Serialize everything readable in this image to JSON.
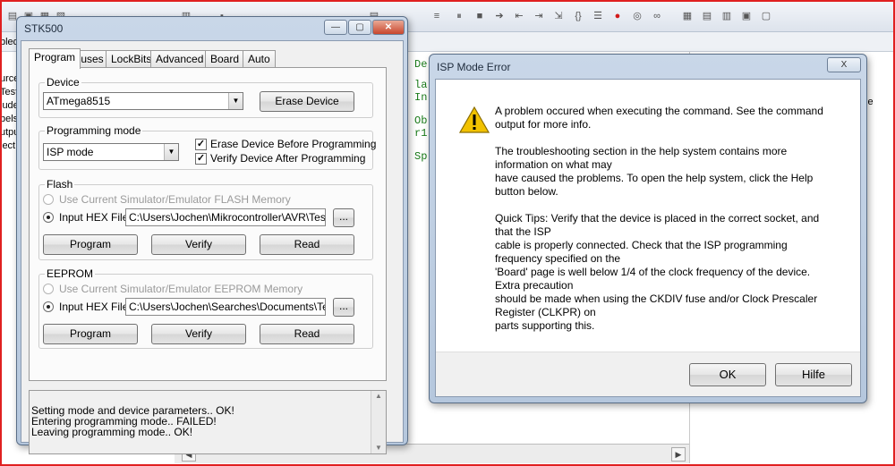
{
  "ide": {
    "left_fragments": [
      "bled",
      "urce",
      "Test",
      "lude",
      "bels",
      "utput",
      "ject"
    ],
    "editor_lines": [
      "De",
      "la",
      "In",
      "Ob",
      "r1",
      "Sp"
    ],
    "right_header": "lue"
  },
  "stk500": {
    "title": "STK500",
    "tabs": [
      "Program",
      "Fuses",
      "LockBits",
      "Advanced",
      "Board",
      "Auto"
    ],
    "device": {
      "label": "Device",
      "selected": "ATmega8515",
      "erase_button": "Erase Device"
    },
    "programming_mode": {
      "label": "Programming mode",
      "selected": "ISP mode",
      "erase_before": "Erase Device Before Programming",
      "verify_after": "Verify Device After Programming"
    },
    "flash": {
      "label": "Flash",
      "use_simulator": "Use Current Simulator/Emulator FLASH Memory",
      "input_hex": "Input HEX File",
      "path": "C:\\Users\\Jochen\\Mikrocontroller\\AVR\\Test\\T",
      "browse": "...",
      "program": "Program",
      "verify": "Verify",
      "read": "Read"
    },
    "eeprom": {
      "label": "EEPROM",
      "use_simulator": "Use Current Simulator/Emulator EEPROM Memory",
      "input_hex": "Input HEX File",
      "path": "C:\\Users\\Jochen\\Searches\\Documents\\Test\\",
      "browse": "...",
      "program": "Program",
      "verify": "Verify",
      "read": "Read"
    },
    "log": [
      "Setting mode and device parameters.. OK!",
      "Entering programming mode.. FAILED!",
      "Leaving programming mode.. OK!"
    ]
  },
  "dialog": {
    "title": "ISP Mode Error",
    "close": "X",
    "p1": [
      "A problem occured when executing the command. See the command",
      "output for more info."
    ],
    "p2": [
      "The troubleshooting section in the help system contains more",
      "information on what may",
      "have caused the problems. To open the help system, click the Help",
      "button below."
    ],
    "p3": [
      "Quick Tips: Verify that the device is placed in the correct socket, and",
      "that the ISP",
      "cable is properly connected. Check that the ISP programming",
      "frequency specified on the",
      "'Board' page is well below 1/4 of the clock frequency of the device.",
      "Extra precaution",
      "should be made when using the CKDIV fuse and/or Clock Prescaler",
      "Register (CLKPR) on",
      "parts supporting this."
    ],
    "ok": "OK",
    "help": "Hilfe"
  },
  "colors": {
    "frame_border": "#e02020",
    "warning": "#f2c200"
  },
  "icons": [
    "warning-icon",
    "minimize-icon",
    "maximize-icon",
    "close-icon"
  ]
}
